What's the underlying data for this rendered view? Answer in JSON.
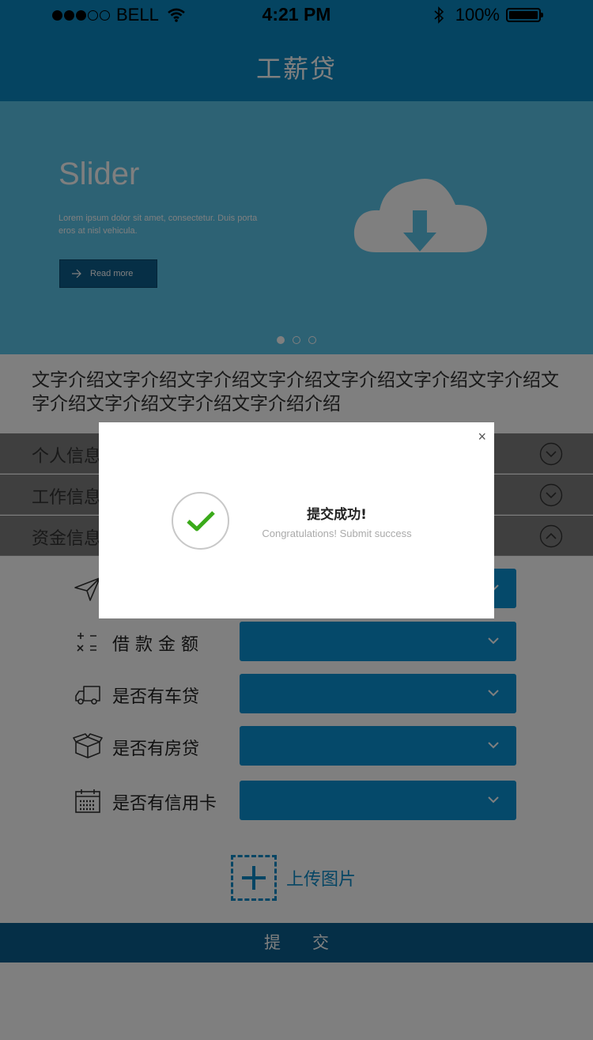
{
  "status_bar": {
    "carrier": "BELL",
    "time": "4:21 PM",
    "battery": "100%"
  },
  "header": {
    "title": "工薪贷"
  },
  "slider": {
    "title": "Slider",
    "text": "Lorem ipsum dolor sit amet, consectetur. Duis porta eros at nisl vehicula.",
    "button_label": "Read more",
    "page_count": 3,
    "active_page": 1
  },
  "intro": {
    "text": "文字介绍文字介绍文字介绍文字介绍文字介绍文字介绍文字介绍文字介绍文字介绍文字介绍文字介绍介绍"
  },
  "sections": [
    {
      "label": "个人信息",
      "state": "collapsed"
    },
    {
      "label": "工作信息",
      "state": "collapsed"
    },
    {
      "label": "资金信息",
      "state": "expanded"
    }
  ],
  "form": {
    "rows": [
      {
        "label": "",
        "icon": "paper-plane-icon"
      },
      {
        "label": "借 款 金 额",
        "icon": "calculator-icon"
      },
      {
        "label": "是否有车贷",
        "icon": "truck-icon"
      },
      {
        "label": "是否有房贷",
        "icon": "box-icon"
      },
      {
        "label": "是否有信用卡",
        "icon": "calendar-icon"
      }
    ],
    "upload_label": "上传图片",
    "submit_label": "提交"
  },
  "modal": {
    "title": "提交成功!",
    "subtitle": "Congratulations!  Submit success",
    "close": "×"
  },
  "colors": {
    "primary": "#0a88c2",
    "slider_bg": "#5bc4e9",
    "select_bg": "#0b93d5",
    "submit_bg": "#0a5f8e",
    "success": "#3aaa1a"
  }
}
